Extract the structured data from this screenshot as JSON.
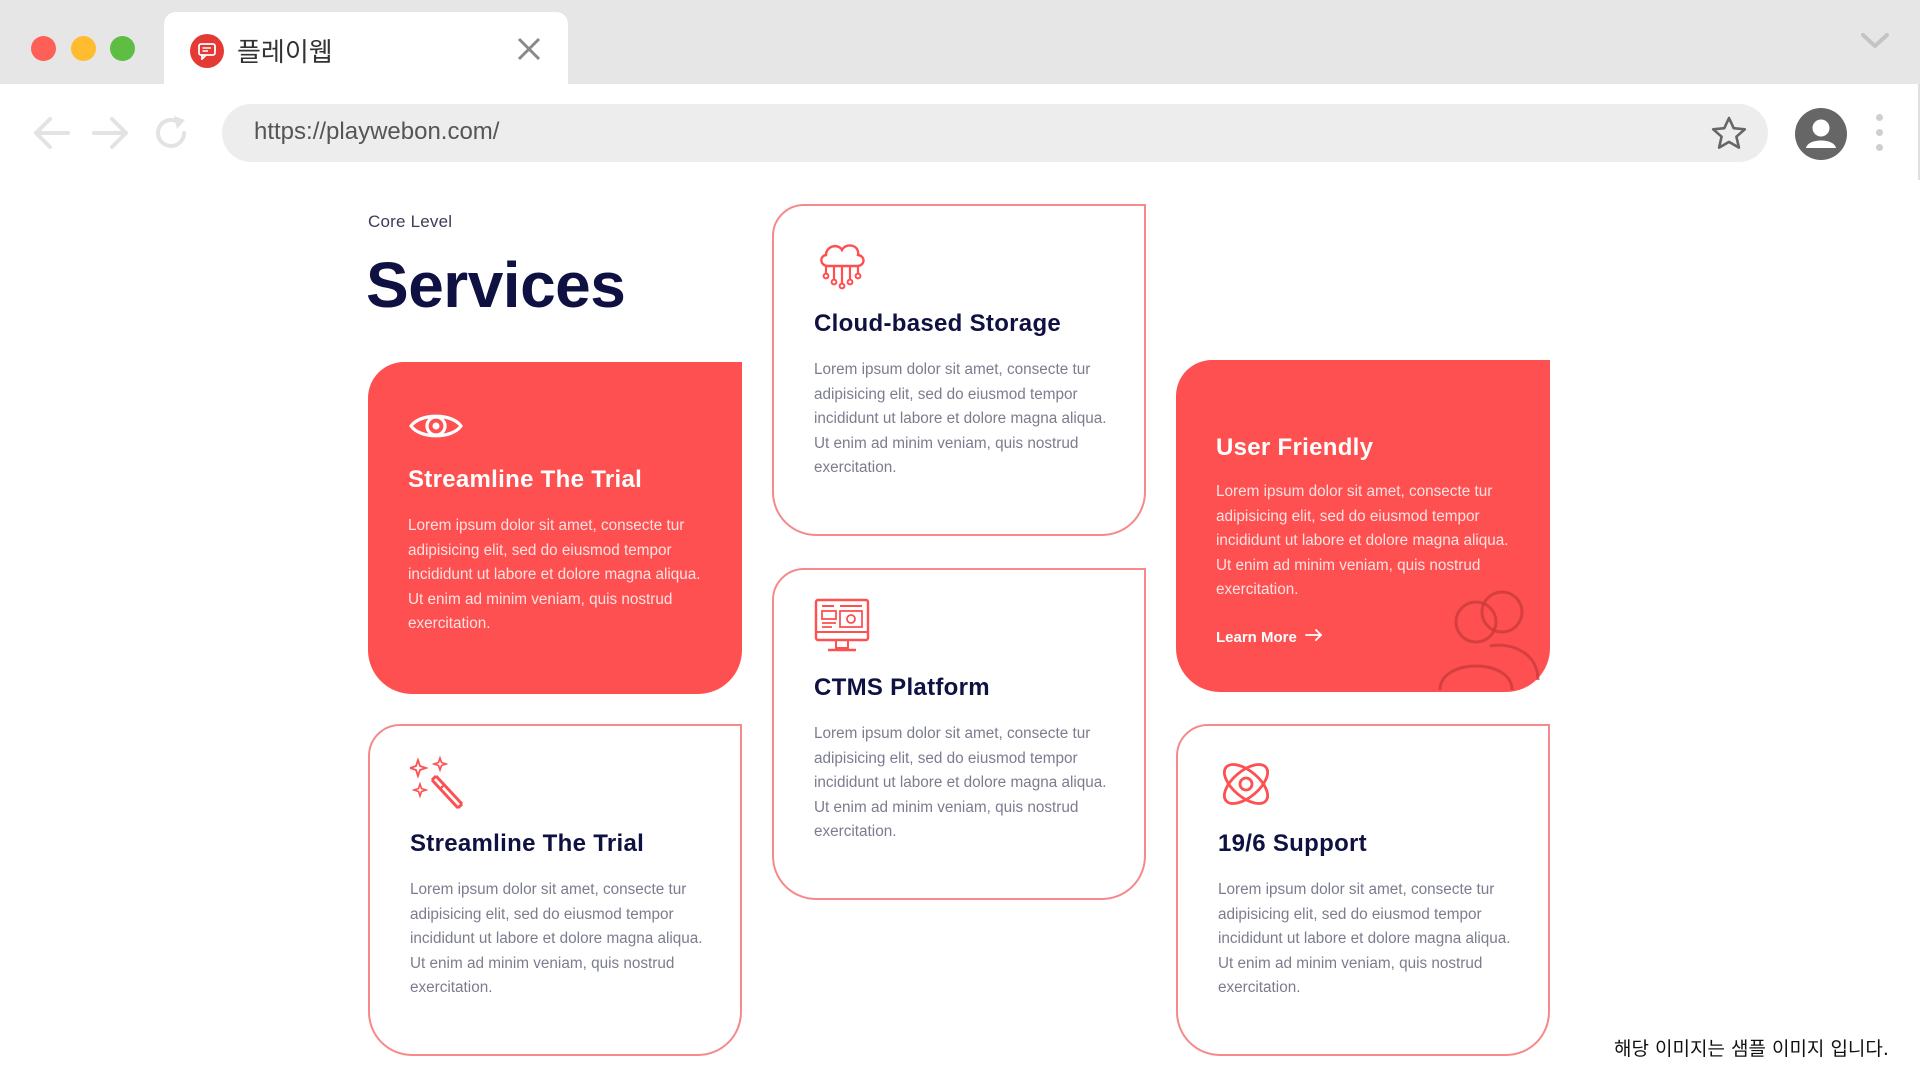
{
  "browser": {
    "tab_title": "플레이웹",
    "url": "https://playwebon.com/",
    "icons": {
      "favicon": "chat-favicon-icon",
      "close": "close-icon",
      "chevron": "chevron-down-icon",
      "back": "arrow-left-icon",
      "forward": "arrow-right-icon",
      "reload": "reload-icon",
      "bookmark": "star-icon",
      "profile": "user-avatar-icon",
      "menu": "kebab-menu-icon"
    },
    "colors": {
      "tabbar": "#e6e6e6",
      "urlbar": "#ededed"
    }
  },
  "section": {
    "eyebrow": "Core Level",
    "heading": "Services"
  },
  "cards": [
    {
      "id": "streamline-trial-1",
      "style": "filled",
      "icon": "eye-icon",
      "title": "Streamline The Trial",
      "description": "Lorem ipsum dolor sit amet, consecte tur adipisicing elit, sed do eiusmod tempor incididunt ut labore et dolore magna aliqua. Ut enim ad minim veniam, quis nostrud exercitation."
    },
    {
      "id": "cloud-storage",
      "style": "outline",
      "icon": "cloud-network-icon",
      "title": "Cloud-based Storage",
      "description": "Lorem ipsum dolor sit amet, consecte tur adipisicing elit, sed do eiusmod tempor incididunt ut labore et dolore magna aliqua. Ut enim ad minim veniam, quis nostrud exercitation."
    },
    {
      "id": "user-friendly",
      "style": "filled",
      "icon": "users-icon",
      "title": "User Friendly",
      "description": "Lorem ipsum dolor sit amet, consecte tur adipisicing elit, sed do eiusmod tempor incididunt ut labore et dolore magna aliqua. Ut enim ad minim veniam, quis nostrud exercitation.",
      "link_label": "Learn More"
    },
    {
      "id": "streamline-trial-2",
      "style": "outline",
      "icon": "magic-wand-icon",
      "title": "Streamline The Trial",
      "description": "Lorem ipsum dolor sit amet, consecte tur adipisicing elit, sed do eiusmod tempor incididunt ut labore et dolore magna aliqua. Ut enim ad minim veniam, quis nostrud exercitation."
    },
    {
      "id": "ctms-platform",
      "style": "outline",
      "icon": "monitor-dashboard-icon",
      "title": "CTMS Platform",
      "description": "Lorem ipsum dolor sit amet, consecte tur adipisicing elit, sed do eiusmod tempor incididunt ut labore et dolore magna aliqua. Ut enim ad minim veniam, quis nostrud exercitation."
    },
    {
      "id": "support",
      "style": "outline",
      "icon": "atom-icon",
      "title": "19/6 Support",
      "description": "Lorem ipsum dolor sit amet, consecte tur adipisicing elit, sed do eiusmod tempor incididunt ut labore et dolore magna aliqua. Ut enim ad minim veniam, quis nostrud exercitation."
    }
  ],
  "colors": {
    "accent": "#fe5050",
    "outline": "#f58a8a",
    "heading": "#0e1141",
    "body_text": "#7b7d8e"
  },
  "footnote": "해당 이미지는 샘플 이미지 입니다."
}
